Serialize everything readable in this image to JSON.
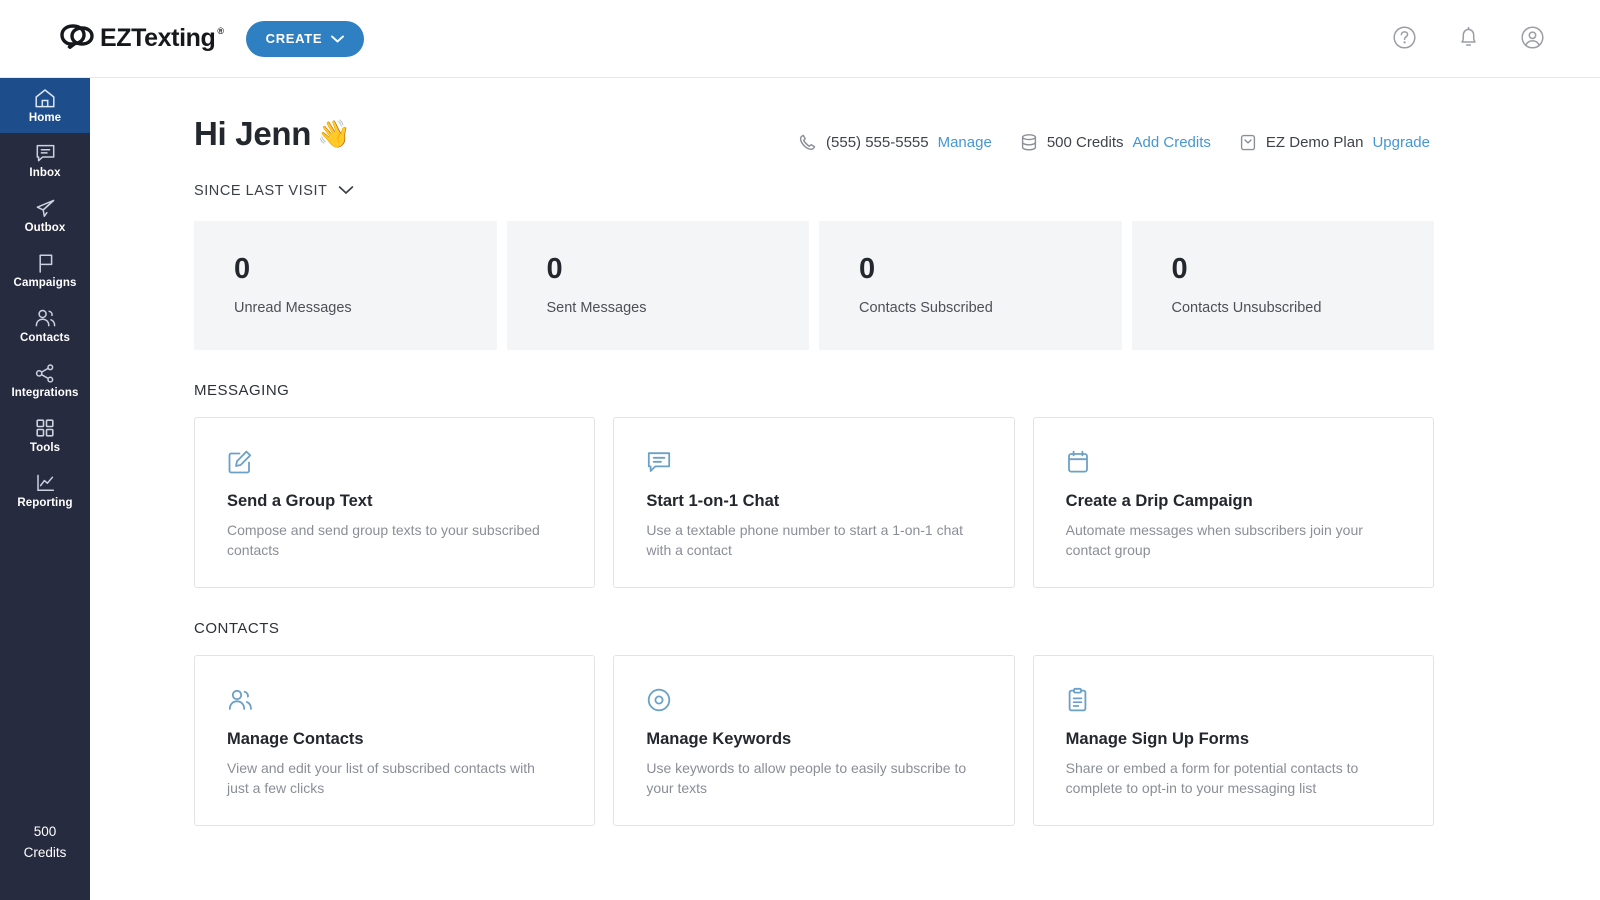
{
  "topbar": {
    "brand_name": "EZTexting",
    "brand_reg": "®",
    "create_label": "CREATE",
    "help_icon": "question-circle-icon",
    "bell_icon": "bell-icon",
    "account_icon": "user-circle-icon"
  },
  "sidebar": {
    "items": [
      {
        "label": "Home",
        "icon": "home-icon",
        "active": true
      },
      {
        "label": "Inbox",
        "icon": "chat-bubble-icon",
        "active": false
      },
      {
        "label": "Outbox",
        "icon": "paper-plane-icon",
        "active": false
      },
      {
        "label": "Campaigns",
        "icon": "flag-icon",
        "active": false
      },
      {
        "label": "Contacts",
        "icon": "people-icon",
        "active": false
      },
      {
        "label": "Integrations",
        "icon": "nodes-icon",
        "active": false
      },
      {
        "label": "Tools",
        "icon": "grid-squares-icon",
        "active": false
      },
      {
        "label": "Reporting",
        "icon": "line-chart-icon",
        "active": false
      }
    ],
    "footer": {
      "credits_number": "500",
      "credits_label": "Credits"
    }
  },
  "header": {
    "greeting": "Hi Jenn",
    "wave_emoji": "👋",
    "phone_number": "(555) 555-5555",
    "phone_link": "Manage",
    "phone_icon": "phone-icon",
    "credits_text": "500 Credits",
    "credits_link": "Add Credits",
    "credits_icon": "database-coins-icon",
    "plan_text": "EZ Demo Plan",
    "plan_link": "Upgrade",
    "plan_icon": "box-chevron-icon",
    "filter_label": "SINCE LAST VISIT",
    "filter_chevron": "chevron-down-icon"
  },
  "stats": [
    {
      "value": "0",
      "label": "Unread Messages"
    },
    {
      "value": "0",
      "label": "Sent Messages"
    },
    {
      "value": "0",
      "label": "Contacts Subscribed"
    },
    {
      "value": "0",
      "label": "Contacts Unsubscribed"
    }
  ],
  "messaging": {
    "section_label": "MESSAGING",
    "cards": [
      {
        "icon": "compose-pencil-icon",
        "title": "Send a Group Text",
        "desc": "Compose and send group texts to your subscribed contacts"
      },
      {
        "icon": "chat-bubble-lines-icon",
        "title": "Start 1-on-1 Chat",
        "desc": "Use a textable phone number to start a 1-on-1 chat with a contact"
      },
      {
        "icon": "calendar-icon",
        "title": "Create a Drip Campaign",
        "desc": "Automate messages when subscribers join your contact group"
      }
    ]
  },
  "contacts": {
    "section_label": "CONTACTS",
    "cards": [
      {
        "icon": "people-icon",
        "title": "Manage Contacts",
        "desc": "View and edit your list of subscribed contacts with just a few clicks"
      },
      {
        "icon": "target-circle-icon",
        "title": "Manage Keywords",
        "desc": "Use keywords to allow people to easily subscribe to your texts"
      },
      {
        "icon": "clipboard-icon",
        "title": "Manage Sign Up Forms",
        "desc": "Share or embed a form for potential contacts to complete to opt-in to your messaging list"
      }
    ]
  },
  "colors": {
    "sidebar_bg": "#272b3f",
    "sidebar_active": "#1e4d8c",
    "accent_blue": "#2f80c2",
    "link_blue": "#4596d4",
    "card_icon_blue": "#6ba0c7",
    "stat_card_bg": "#f4f5f7"
  }
}
